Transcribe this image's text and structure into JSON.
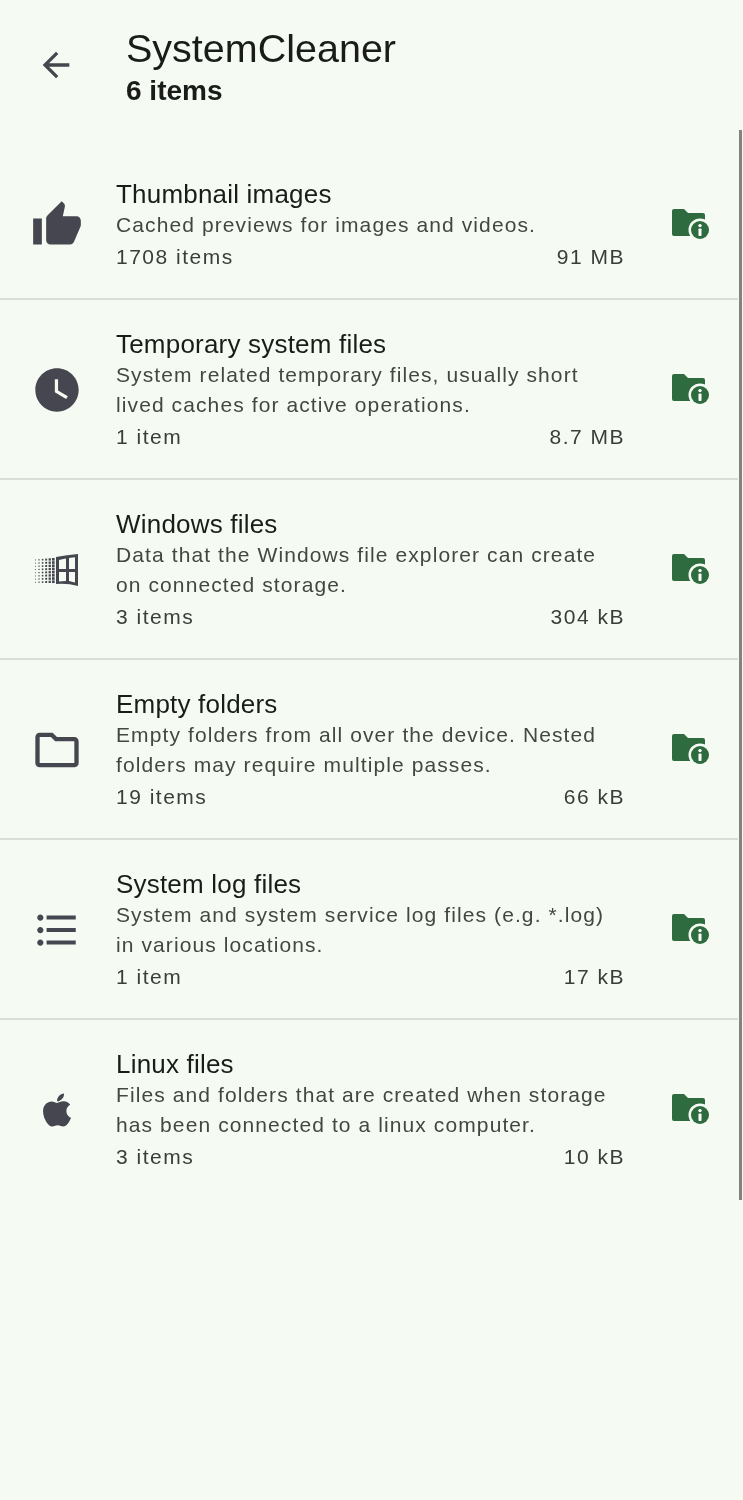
{
  "header": {
    "title": "SystemCleaner",
    "subtitle": "6 items"
  },
  "items": [
    {
      "kind": "thumbnails",
      "title": "Thumbnail images",
      "description": "Cached previews for images and videos.",
      "count": "1708 items",
      "size": "91 MB"
    },
    {
      "kind": "temporary",
      "title": "Temporary system files",
      "description": "System related temporary files, usually short lived caches for active operations.",
      "count": "1 item",
      "size": "8.7 MB"
    },
    {
      "kind": "windows",
      "title": "Windows files",
      "description": "Data that the Windows file explorer can create on connected storage.",
      "count": "3 items",
      "size": "304 kB"
    },
    {
      "kind": "empty_folders",
      "title": "Empty folders",
      "description": "Empty folders from all over the device. Nested folders may require multiple passes.",
      "count": "19 items",
      "size": "66 kB"
    },
    {
      "kind": "logs",
      "title": "System log files",
      "description": "System and system service log files (e.g. *.log) in various locations.",
      "count": "1 item",
      "size": "17 kB"
    },
    {
      "kind": "linux",
      "title": "Linux files",
      "description": "Files and folders that are created when storage has been connected to a linux computer.",
      "count": "3 items",
      "size": "10 kB"
    }
  ]
}
